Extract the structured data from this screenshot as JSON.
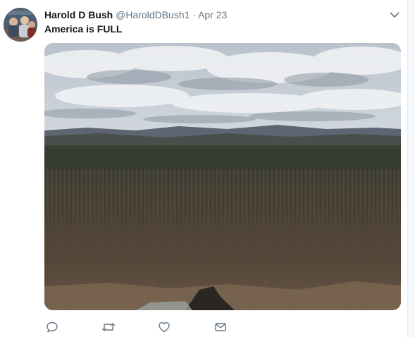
{
  "tweet": {
    "display_name": "Harold D Bush",
    "handle": "@HaroldDBush1",
    "separator": "·",
    "timestamp": "Apr 23",
    "text": "America is FULL"
  },
  "icons": {
    "caret": "chevron-down-icon",
    "reply": "reply-icon",
    "retweet": "retweet-icon",
    "like": "heart-icon",
    "message": "envelope-icon"
  },
  "colors": {
    "text_primary": "#14171a",
    "text_secondary": "#657786",
    "icon": "#657786"
  }
}
